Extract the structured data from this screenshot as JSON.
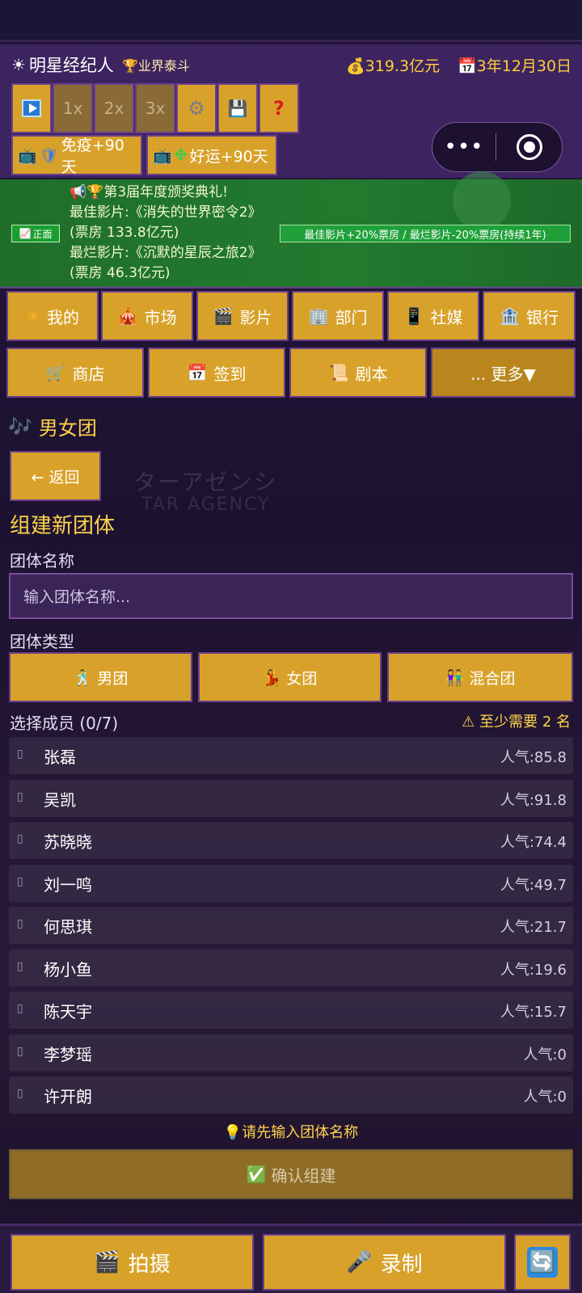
{
  "header": {
    "title": "明星经纪人",
    "rank": "业界泰斗",
    "money": "319.3亿元",
    "date": "3年12月30日",
    "speed_1x": "1x",
    "speed_2x": "2x",
    "speed_3x": "3x",
    "help": "?",
    "buff_immune": "免疫+90天",
    "buff_luck": "好运+90天",
    "capsule_dots": "•••"
  },
  "news": {
    "tag": "正面",
    "line1": "第3届年度颁奖典礼!",
    "line2": "最佳影片:《消失的世界密令2》(票房 133.8亿元)",
    "line3": "最烂影片:《沉默的星辰之旅2》(票房 46.3亿元)",
    "effect": "最佳影片+20%票房 / 最烂影片-20%票房(持续1年)"
  },
  "nav": {
    "mine": "我的",
    "market": "市场",
    "films": "影片",
    "dept": "部门",
    "social": "社媒",
    "bank": "银行",
    "shop": "商店",
    "checkin": "签到",
    "script": "剧本",
    "more": "... 更多▼"
  },
  "page": {
    "section": "男女团",
    "back": "← 返回",
    "heading": "组建新团体",
    "name_label": "团体名称",
    "name_placeholder": "输入团体名称...",
    "type_label": "团体类型",
    "type_boy": "男团",
    "type_girl": "女团",
    "type_mixed": "混合团",
    "members_label": "选择成员 (0/7)",
    "warning": "至少需要 2 名",
    "hint": "请先输入团体名称",
    "confirm": "确认组建"
  },
  "members": [
    {
      "name": "张磊",
      "pop": "人气:85.8"
    },
    {
      "name": "吴凯",
      "pop": "人气:91.8"
    },
    {
      "name": "苏晓晓",
      "pop": "人气:74.4"
    },
    {
      "name": "刘一鸣",
      "pop": "人气:49.7"
    },
    {
      "name": "何思琪",
      "pop": "人气:21.7"
    },
    {
      "name": "杨小鱼",
      "pop": "人气:19.6"
    },
    {
      "name": "陈天宇",
      "pop": "人气:15.7"
    },
    {
      "name": "李梦瑶",
      "pop": "人气:0"
    },
    {
      "name": "许开朗",
      "pop": "人气:0"
    }
  ],
  "bottom": {
    "shoot": "拍摄",
    "record": "录制"
  },
  "colors": {
    "gold": "#d8a22a",
    "accent_text": "#ffd24a",
    "header_bg": "#3d2460",
    "news_bg": "#227a2f"
  }
}
